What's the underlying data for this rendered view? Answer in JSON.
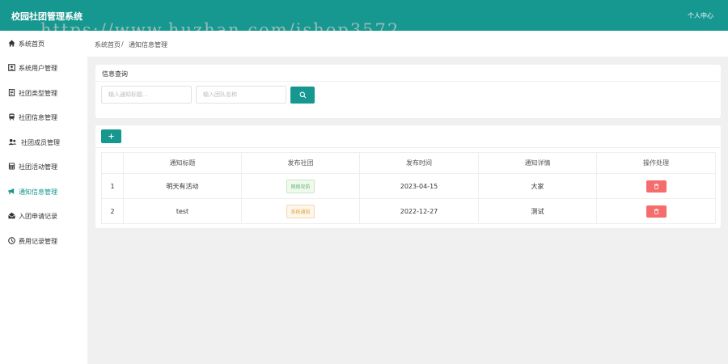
{
  "header": {
    "title": "校园社团管理系统",
    "user_center": "个人中心",
    "watermark": "https://www.huzhan.com/ishop3572"
  },
  "sidebar": {
    "items": [
      {
        "label": "系统首页",
        "icon": "home-icon"
      },
      {
        "label": "系统用户管理",
        "icon": "user-card-icon"
      },
      {
        "label": "社团类型管理",
        "icon": "document-icon"
      },
      {
        "label": "社团信息管理",
        "icon": "train-icon"
      },
      {
        "label": "社团成员管理",
        "icon": "users-icon"
      },
      {
        "label": "社团活动管理",
        "icon": "calculator-icon"
      },
      {
        "label": "通知信息管理",
        "icon": "bullhorn-icon",
        "active": true
      },
      {
        "label": "入团申请记录",
        "icon": "envelope-icon"
      },
      {
        "label": "费用记录管理",
        "icon": "clock-icon"
      }
    ]
  },
  "breadcrumb": {
    "home": "系统首页",
    "separator": "/",
    "current": "通知信息管理"
  },
  "search": {
    "title": "信息查询",
    "title_placeholder": "输入通知标题...",
    "team_placeholder": "输入团队名称"
  },
  "table": {
    "headers": [
      "",
      "通知标题",
      "发布社团",
      "发布时间",
      "通知详情",
      "操作处理"
    ],
    "rows": [
      {
        "index": "1",
        "title": "明天有活动",
        "team": "网络攻防",
        "team_color": "green",
        "time": "2023-04-15",
        "detail": "大家"
      },
      {
        "index": "2",
        "title": "test",
        "team": "系统通知",
        "team_color": "orange",
        "time": "2022-12-27",
        "detail": "测试"
      }
    ]
  },
  "colors": {
    "primary": "#16978f",
    "danger": "#f56c6c"
  }
}
